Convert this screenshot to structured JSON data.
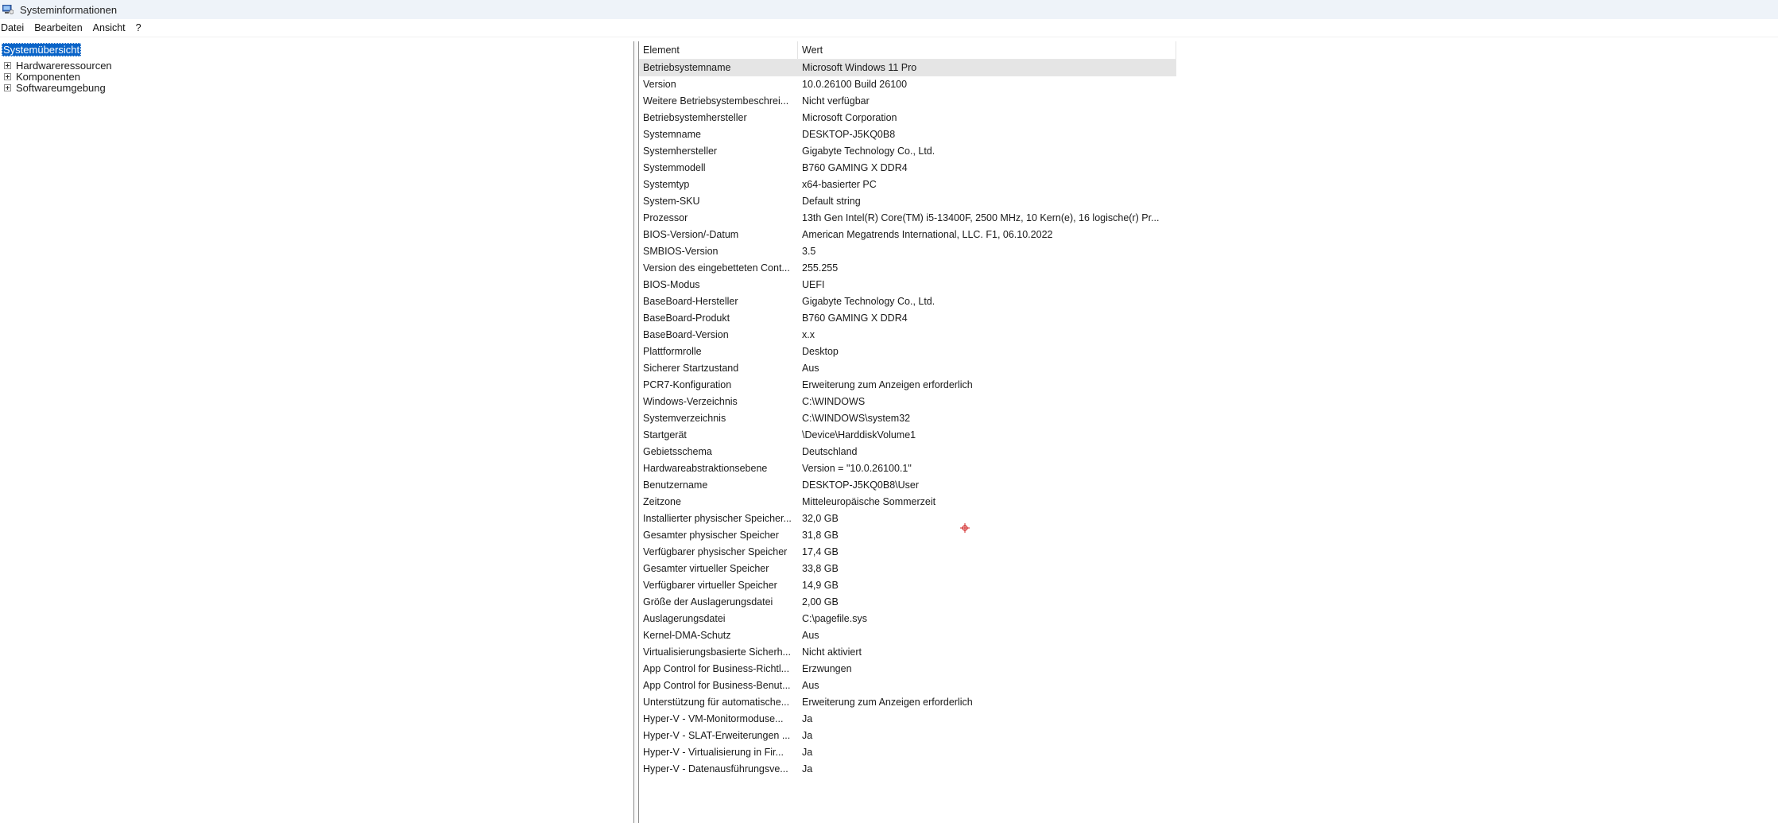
{
  "window": {
    "title": "Systeminformationen",
    "icon": "system-information-icon"
  },
  "menu": [
    "Datei",
    "Bearbeiten",
    "Ansicht",
    "?"
  ],
  "tree": {
    "root": "Systemübersicht",
    "children": [
      "Hardwareressourcen",
      "Komponenten",
      "Softwareumgebung"
    ]
  },
  "table": {
    "headers": [
      "Element",
      "Wert"
    ],
    "rows": [
      {
        "element": "Betriebsystemname",
        "value": "Microsoft Windows 11 Pro"
      },
      {
        "element": "Version",
        "value": "10.0.26100 Build 26100"
      },
      {
        "element": "Weitere Betriebsystembeschrei...",
        "value": "Nicht verfügbar"
      },
      {
        "element": "Betriebsystemhersteller",
        "value": "Microsoft Corporation"
      },
      {
        "element": "Systemname",
        "value": "DESKTOP-J5KQ0B8"
      },
      {
        "element": "Systemhersteller",
        "value": "Gigabyte Technology Co., Ltd."
      },
      {
        "element": "Systemmodell",
        "value": "B760 GAMING X DDR4"
      },
      {
        "element": "Systemtyp",
        "value": "x64-basierter PC"
      },
      {
        "element": "System-SKU",
        "value": "Default string"
      },
      {
        "element": "Prozessor",
        "value": "13th Gen Intel(R) Core(TM) i5-13400F, 2500 MHz, 10 Kern(e), 16 logische(r) Pr..."
      },
      {
        "element": "BIOS-Version/-Datum",
        "value": "American Megatrends International, LLC. F1, 06.10.2022"
      },
      {
        "element": "SMBIOS-Version",
        "value": "3.5"
      },
      {
        "element": "Version des eingebetteten Cont...",
        "value": "255.255"
      },
      {
        "element": "BIOS-Modus",
        "value": "UEFI"
      },
      {
        "element": "BaseBoard-Hersteller",
        "value": "Gigabyte Technology Co., Ltd."
      },
      {
        "element": "BaseBoard-Produkt",
        "value": "B760 GAMING X DDR4"
      },
      {
        "element": "BaseBoard-Version",
        "value": "x.x"
      },
      {
        "element": "Plattformrolle",
        "value": "Desktop"
      },
      {
        "element": "Sicherer Startzustand",
        "value": "Aus"
      },
      {
        "element": "PCR7-Konfiguration",
        "value": "Erweiterung zum Anzeigen erforderlich"
      },
      {
        "element": "Windows-Verzeichnis",
        "value": "C:\\WINDOWS"
      },
      {
        "element": "Systemverzeichnis",
        "value": "C:\\WINDOWS\\system32"
      },
      {
        "element": "Startgerät",
        "value": "\\Device\\HarddiskVolume1"
      },
      {
        "element": "Gebietsschema",
        "value": "Deutschland"
      },
      {
        "element": "Hardwareabstraktionsebene",
        "value": "Version = \"10.0.26100.1\""
      },
      {
        "element": "Benutzername",
        "value": "DESKTOP-J5KQ0B8\\User"
      },
      {
        "element": "Zeitzone",
        "value": "Mitteleuropäische Sommerzeit"
      },
      {
        "element": "Installierter physischer Speicher...",
        "value": "32,0 GB"
      },
      {
        "element": "Gesamter physischer Speicher",
        "value": "31,8 GB"
      },
      {
        "element": "Verfügbarer physischer Speicher",
        "value": "17,4 GB"
      },
      {
        "element": "Gesamter virtueller Speicher",
        "value": "33,8 GB"
      },
      {
        "element": "Verfügbarer virtueller Speicher",
        "value": "14,9 GB"
      },
      {
        "element": "Größe der Auslagerungsdatei",
        "value": "2,00 GB"
      },
      {
        "element": "Auslagerungsdatei",
        "value": "C:\\pagefile.sys"
      },
      {
        "element": "Kernel-DMA-Schutz",
        "value": "Aus"
      },
      {
        "element": "Virtualisierungsbasierte Sicherh...",
        "value": "Nicht aktiviert"
      },
      {
        "element": "App Control for Business-Richtl...",
        "value": "Erzwungen"
      },
      {
        "element": "App Control for Business-Benut...",
        "value": "Aus"
      },
      {
        "element": "Unterstützung für automatische...",
        "value": "Erweiterung zum Anzeigen erforderlich"
      },
      {
        "element": "Hyper-V - VM-Monitormoduse...",
        "value": "Ja"
      },
      {
        "element": "Hyper-V - SLAT-Erweiterungen ...",
        "value": "Ja"
      },
      {
        "element": "Hyper-V - Virtualisierung in Fir...",
        "value": "Ja"
      },
      {
        "element": "Hyper-V - Datenausführungsve...",
        "value": "Ja"
      }
    ]
  },
  "colors": {
    "selection": "#0a64c8",
    "row_highlight": "#e5e5e5",
    "titlebar": "#eef3f9",
    "cursor": "#d02020"
  }
}
